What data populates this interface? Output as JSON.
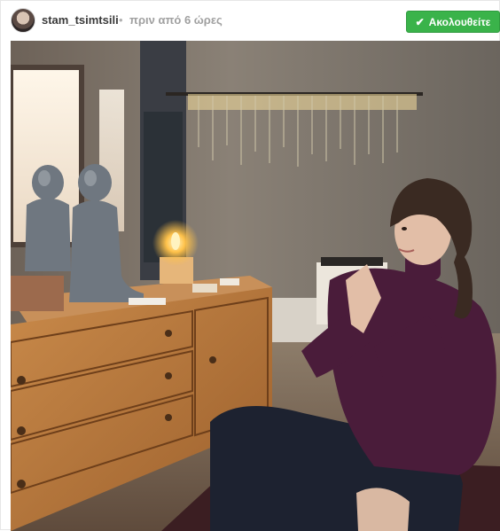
{
  "header": {
    "username": "stam_tsimtsili",
    "separator": "•",
    "timestamp": "πριν από 6 ώρες",
    "follow_label": "Ακολουθείτε",
    "follow_icon": "check-icon"
  },
  "colors": {
    "follow_button": "#3ab34a",
    "username": "#3a3a3a",
    "timestamp": "#a0a0a0"
  },
  "photo": {
    "description_icon": "photo-image"
  }
}
